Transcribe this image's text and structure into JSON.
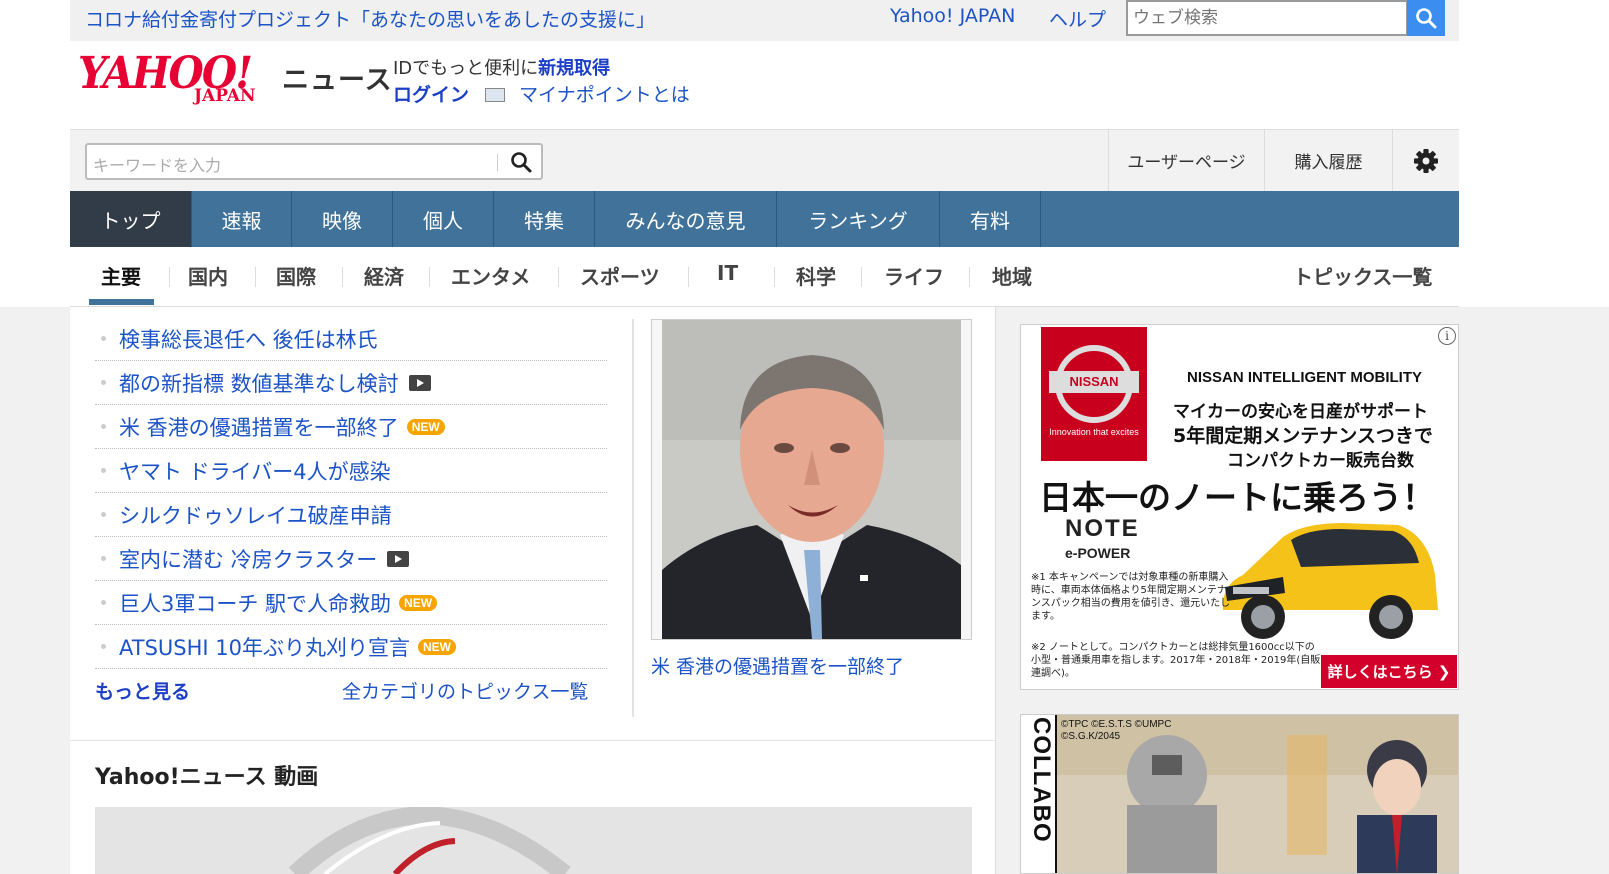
{
  "top_strip": {
    "promo": "コロナ給付金寄付プロジェクト「あなたの思いをあしたの支援に」",
    "yahoo_japan": "Yahoo! JAPAN",
    "help": "ヘルプ",
    "web_search_placeholder": "ウェブ検索"
  },
  "logo": {
    "yahoo": "YAHOO!",
    "japan": "JAPAN",
    "news": "ニュース"
  },
  "account": {
    "id_prefix": "IDでもっと便利に",
    "signup": "新規取得",
    "login": "ログイン",
    "mynumber": "マイナポイントとは"
  },
  "search": {
    "placeholder": "キーワードを入力"
  },
  "right_links": {
    "user_page": "ユーザーページ",
    "purchase_history": "購入履歴"
  },
  "main_nav": [
    "トップ",
    "速報",
    "映像",
    "個人",
    "特集",
    "みんなの意見",
    "ランキング",
    "有料"
  ],
  "sub_nav": [
    "主要",
    "国内",
    "国際",
    "経済",
    "エンタメ",
    "スポーツ",
    "IT",
    "科学",
    "ライフ",
    "地域"
  ],
  "topics_list_link": "トピックス一覧",
  "topics": [
    {
      "title": "検事総長退任へ 後任は林氏",
      "badge": ""
    },
    {
      "title": "都の新指標 数値基準なし検討",
      "badge": "video"
    },
    {
      "title": "米 香港の優遇措置を一部終了",
      "badge": "NEW"
    },
    {
      "title": "ヤマト ドライバー4人が感染",
      "badge": ""
    },
    {
      "title": "シルクドゥソレイユ破産申請",
      "badge": ""
    },
    {
      "title": "室内に潜む 冷房クラスター",
      "badge": "video"
    },
    {
      "title": "巨人3軍コーチ 駅で人命救助",
      "badge": "NEW"
    },
    {
      "title": "ATSUSHI 10年ぶり丸刈り宣言",
      "badge": "NEW"
    }
  ],
  "more": "もっと見る",
  "all_topics": "全カテゴリのトピックス一覧",
  "photo_caption": "米 香港の優遇措置を一部終了",
  "video_section_title": "Yahoo!ニュース 動画",
  "ad1": {
    "brand": "NISSAN",
    "tagline": "Innovation that excites",
    "intelligent": "NISSAN INTELLIGENT MOBILITY",
    "line1": "マイカーの安心を日産がサポート",
    "line2": "5年間定期メンテナンスつきで",
    "line3": "コンパクトカー販売台数",
    "headline": "日本一のノートに乗ろう！",
    "model": "NOTE",
    "powertrain": "e-POWER",
    "fine1": "※1 本キャンペーンでは対象車種の新車購入時に、車両本体価格より5年間定期メンテナンスパック相当の費用を値引き、還元いたします。",
    "fine2": "※2 ノートとして。コンパクトカーとは総排気量1600cc以下の小型・普通乗用車を指します。2017年・2018年・2019年(自販連調べ)。",
    "cta": "詳しくはこちら ❯"
  },
  "ad2": {
    "vertical_text": "COLLABO",
    "copyright1": "©TPC ©E.S.T.S ©UMPC",
    "copyright2": "©S.G.K/2045"
  }
}
